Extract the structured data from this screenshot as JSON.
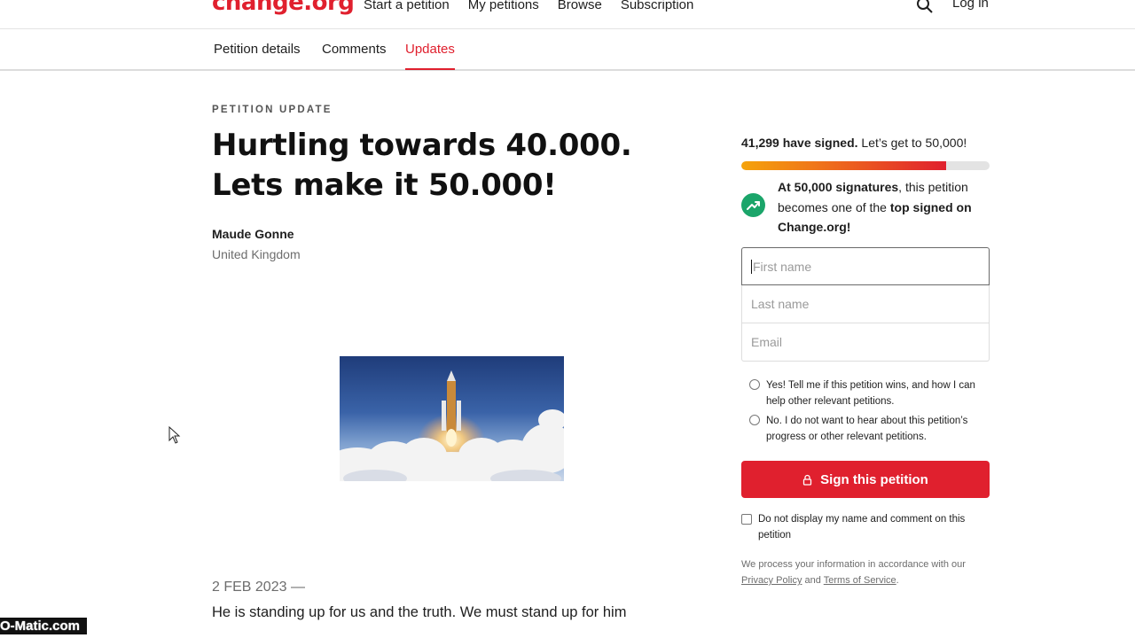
{
  "header": {
    "logo": "change.org",
    "nav": [
      "Start a petition",
      "My petitions",
      "Browse",
      "Subscription"
    ],
    "login": "Log in"
  },
  "tabs": [
    "Petition details",
    "Comments",
    "Updates"
  ],
  "active_tab": "Updates",
  "update": {
    "eyebrow": "PETITION UPDATE",
    "title": "Hurtling towards 40.000. Lets make it 50.000!",
    "author": "Maude Gonne",
    "location": "United Kingdom",
    "date": "2 FEB 2023 —",
    "body": "He is standing up for us and the truth. We must stand up for him"
  },
  "sidebar": {
    "signed_count": "41,299 have signed.",
    "signed_goal": " Let’s get to 50,000!",
    "progress": 0.826,
    "goal_bold": "At 50,000 signatures",
    "goal_mid": ", this petition becomes one of the ",
    "goal_bold2": "top signed on Change.org!",
    "first_name_placeholder": "First name",
    "last_name_placeholder": "Last name",
    "email_placeholder": "Email",
    "opt_in": "Yes! Tell me if this petition wins, and how I can help other relevant petitions.",
    "opt_out": "No. I do not want to hear about this petition’s progress or other relevant petitions.",
    "sign_button": "Sign this petition",
    "hide_name": "Do not display my name and comment on this petition",
    "legal_prefix": "We process your information in accordance with our ",
    "privacy_link": "Privacy Policy",
    "legal_and": " and ",
    "terms_link": "Terms of Service",
    "legal_suffix": "."
  },
  "watermark": "O-Matic.com",
  "colors": {
    "brand": "#e0202e",
    "success": "#1ba56a"
  }
}
